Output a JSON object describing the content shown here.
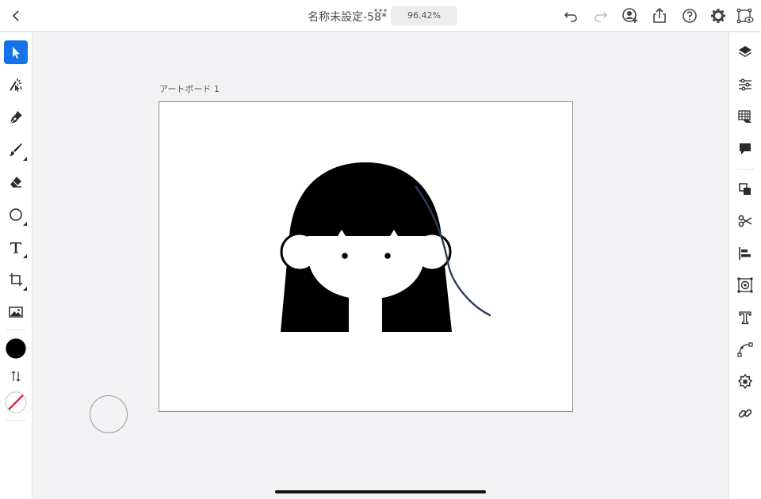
{
  "app": {
    "document_title": "名称未設定-58*",
    "zoom_level": "96.42%"
  },
  "canvas": {
    "artboard_label": "アートボード 1"
  },
  "colors": {
    "accent": "#1473e6",
    "fill_color": "#000000",
    "stroke_color": "none",
    "path_highlight": "#2d3b5a"
  },
  "toolbar_left": {
    "tools": [
      "selection-tool",
      "direct-selection-tool",
      "pen-tool",
      "brush-tool",
      "eraser-tool",
      "shape-tool",
      "type-tool",
      "transform-tool",
      "image-tool"
    ],
    "active_tool": "selection-tool"
  },
  "topbar_right": [
    "undo-icon",
    "redo-icon",
    "invite-icon",
    "share-icon",
    "help-icon",
    "settings-icon",
    "preview-icon"
  ],
  "right_panel": [
    "layers-icon",
    "properties-icon",
    "libraries-icon",
    "comments-icon",
    "combine-icon",
    "cut-icon",
    "align-icon",
    "repeat-icon",
    "type-options-icon",
    "path-icon",
    "pattern-icon",
    "links-icon"
  ]
}
